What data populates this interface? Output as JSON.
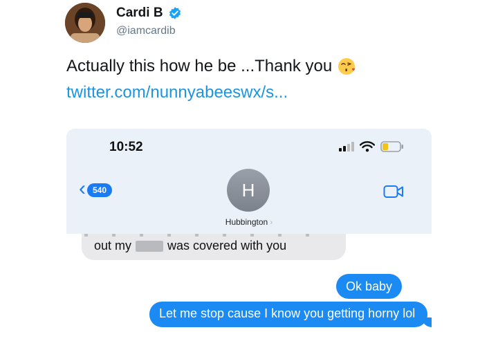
{
  "tweet": {
    "display_name": "Cardi B",
    "handle": "@iamcardib",
    "verified": true,
    "text": "Actually this how he be ...Thank you",
    "emoji": "face-blowing-a-kiss",
    "link": "twitter.com/nunnyabeeswx/s..."
  },
  "phone": {
    "time": "10:52",
    "back_count": "540",
    "contact": {
      "initial": "H",
      "name": "Hubbington"
    },
    "messages": [
      {
        "direction": "incoming",
        "before": "out my",
        "after": "was covered with you"
      },
      {
        "direction": "outgoing",
        "text": "Ok baby"
      },
      {
        "direction": "outgoing",
        "text": "Let me stop cause I know you getting horny lol"
      }
    ]
  },
  "colors": {
    "link": "#1b95e0",
    "imessage_blue": "#1b8af3",
    "incoming_gray": "#e9e9eb",
    "verified_blue": "#1da1f2"
  }
}
